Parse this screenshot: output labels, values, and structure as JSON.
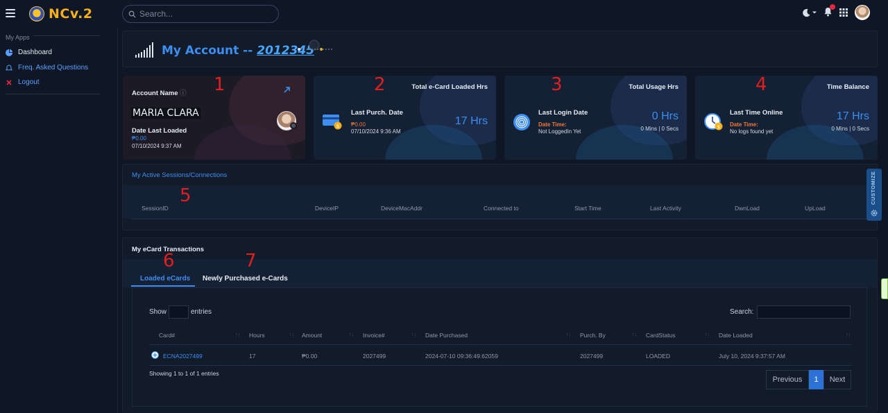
{
  "app": {
    "logo_text": "NCv.2",
    "brand_color": "#f6b01e",
    "accent": "#3d8ef0"
  },
  "search": {
    "placeholder": "Search..."
  },
  "sidebar": {
    "heading": "My Apps",
    "items": [
      {
        "label": "Dashboard",
        "icon": "pie-chart-icon"
      },
      {
        "label": "Freq. Asked Questions",
        "icon": "bell-icon"
      },
      {
        "label": "Logout",
        "icon": "close-icon"
      }
    ]
  },
  "header": {
    "title": "My Account --",
    "account_id": "2012345"
  },
  "annotations": [
    "1",
    "2",
    "3",
    "4",
    "5",
    "6",
    "7"
  ],
  "cards": {
    "account": {
      "label": "Account Name",
      "name": "MARIA CLARA",
      "date_label": "Date Last Loaded",
      "amount": "₱0.00",
      "datetime": "07/10/2024 9:37 AM"
    },
    "ecard": {
      "title": "Total e-Card Loaded Hrs",
      "label": "Last Purch. Date",
      "amount": "₱0.00",
      "datetime": "07/10/2024 9:36 AM",
      "hours": "17 Hrs"
    },
    "usage": {
      "title": "Total Usage Hrs",
      "label": "Last Login Date",
      "sub_label": "Date Time:",
      "sub_value": "Not LoggedIn Yet",
      "hours": "0 Hrs",
      "mins": "0 Mins | 0 Secs"
    },
    "balance": {
      "title": "Time Balance",
      "label": "Last Time Online",
      "sub_label": "Date Time:",
      "sub_value": "No logs found yet",
      "hours": "17 Hrs",
      "mins": "0 Mins | 0 Secs"
    }
  },
  "sessions": {
    "title": "My Active Sessions/Connections",
    "columns": [
      "SessionID",
      "DeviceIP",
      "DeviceMacAddr",
      "Connected to",
      "Start Time",
      "Last Activity",
      "DwnLoad",
      "UpLoad"
    ]
  },
  "customize_label": "CUSTOMIZE",
  "transactions": {
    "title": "My eCard Transactions",
    "tabs": [
      "Loaded eCards",
      "Newly Purchased e-Cards"
    ],
    "show_label": "Show",
    "entries_label": "entries",
    "search_label": "Search:",
    "columns": [
      "Card#",
      "Hours",
      "Amount",
      "Invoice#",
      "Date Purchased",
      "Purch. By",
      "CardStatus",
      "Date Loaded"
    ],
    "rows": [
      {
        "card": "ECNA2027499",
        "hours": "17",
        "amount": "₱0.00",
        "invoice": "2027499",
        "date_purchased": "2024-07-10 09:36:49.62059",
        "purch_by": "2027499",
        "status": "LOADED",
        "date_loaded": "July 10, 2024 9:37:57 AM"
      }
    ],
    "info": "Showing 1 to 1 of 1 entries",
    "pagination": {
      "previous": "Previous",
      "current": "1",
      "next": "Next"
    }
  }
}
